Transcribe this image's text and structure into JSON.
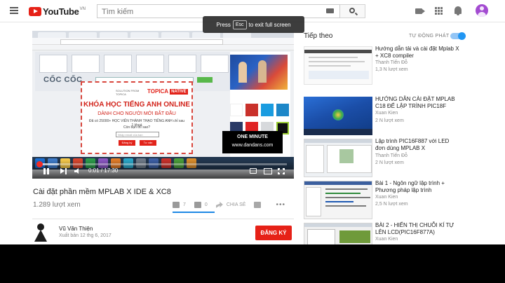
{
  "header": {
    "logo_text": "YouTube",
    "logo_country": "VN",
    "search_placeholder": "Tìm kiếm"
  },
  "fullscreen_toast": {
    "before": "Press",
    "key": "Esc",
    "after": "to exit full screen"
  },
  "player": {
    "time": "0:01 / 17:30",
    "progress_fraction": 0.001,
    "loaded_fraction": 0.08,
    "screen": {
      "coccoc_logo": "CỐC CỐC",
      "ad_brand": "TOPICA",
      "ad_brand_tag": "NATIVE",
      "ad_small_text": "SOLUTION FROM TOPICA",
      "ad_title": "KHÓA HỌC TIẾNG ANH ONLINE",
      "ad_subtitle": "DÀNH CHO NGƯỜI MỚI BẮT ĐẦU",
      "ad_line": "Đã có 25000+ HỌC VIÊN THÀNH THẠO TIẾNG ANH chỉ sau 1 khoá",
      "ad_line2": "Còn bạn thì sao?",
      "ad_input": "Nhập email của bạn",
      "ad_btn1": "Đăng ký",
      "ad_btn2": "Tư vấn",
      "overlay_title": "ONE MINUTE",
      "overlay_url": "www.dandans.com"
    }
  },
  "video": {
    "title": "Cài đặt phần mềm MPLAB X IDE & XC8",
    "views": "1.289 lượt xem",
    "likes": "7",
    "dislikes": "0",
    "like_fraction": 1.0,
    "share_label": "CHIA SẺ",
    "more_label": "•••"
  },
  "channel": {
    "name": "Vũ Văn Thiện",
    "published": "Xuất bản 12 thg 6, 2017",
    "subscribe_label": "ĐĂNG KÝ"
  },
  "sidebar": {
    "up_next": "Tiếp theo",
    "autoplay": "TỰ ĐỘNG PHÁT",
    "autoplay_on": true,
    "items": [
      {
        "title": "Hướng dẫn tải và cài đặt Mplab X + XC8 compiler",
        "channel": "Thanh Tiến Đỗ",
        "views": "1,3 N lượt xem",
        "thumb": "doc"
      },
      {
        "title": "HƯỚNG DẪN CÀI ĐẶT MPLAB C18 ĐỂ LẬP TRÌNH PIC18F",
        "channel": "Xuan Kien",
        "views": "2 N lượt xem",
        "thumb": "win7"
      },
      {
        "title": "Lập trình PIC16F887 với LED đơn dùng MPLAB X",
        "channel": "Thanh Tiến Đỗ",
        "views": "2 N lượt xem",
        "thumb": "ide"
      },
      {
        "title": "Bài 1 - Ngôn ngữ lập trình + Phương pháp lập trình",
        "channel": "Xuan Kien",
        "views": "2,5 N lượt xem",
        "thumb": "code"
      },
      {
        "title": "BÀI 2 - HIỂN THỊ CHUỖI KÍ TỰ LÊN LCD(PIC16F877A)",
        "channel": "Xuan Kien",
        "views": "",
        "thumb": "lcd"
      }
    ]
  }
}
